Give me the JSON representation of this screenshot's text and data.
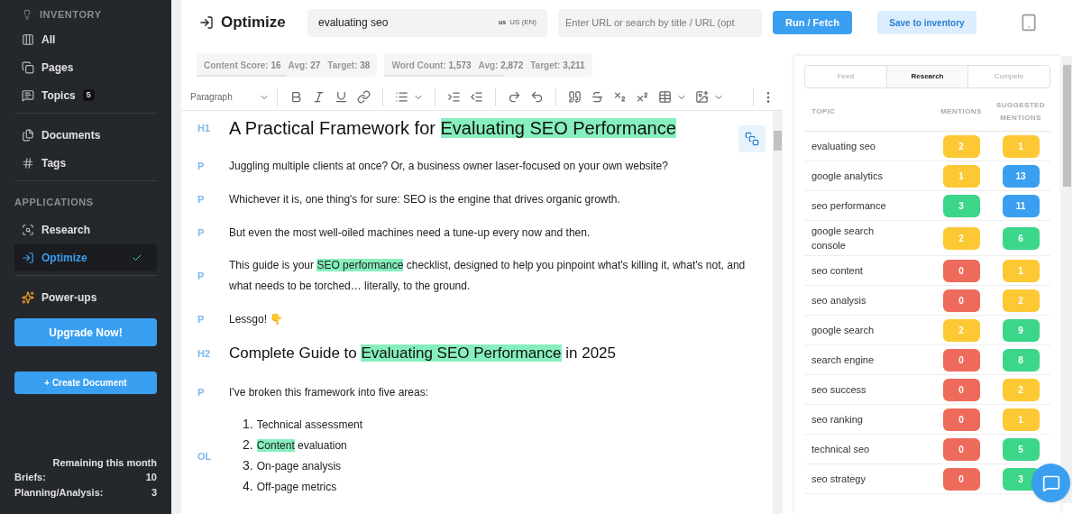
{
  "sidebar": {
    "sections": [
      {
        "heading": "INVENTORY",
        "items": [
          {
            "label": "All",
            "selected": false
          },
          {
            "label": "Pages",
            "selected": false
          },
          {
            "label": "Topics",
            "badge": "5",
            "selected": false
          }
        ]
      },
      {
        "items": [
          {
            "label": "Documents",
            "selected": false
          },
          {
            "label": "Tags",
            "selected": false
          }
        ]
      },
      {
        "heading": "APPLICATIONS",
        "items": [
          {
            "label": "Research",
            "selected": false
          },
          {
            "label": "Optimize",
            "selected": true
          }
        ]
      },
      {
        "items": [
          {
            "label": "Power-ups",
            "selected": false
          }
        ]
      }
    ],
    "upgrade_button": "Upgrade Now!",
    "create_button": "+ Create Document",
    "quota": {
      "title": "Remaining this month",
      "rows": [
        {
          "label": "Briefs:",
          "value": "10"
        },
        {
          "label": "Planning/Analysis:",
          "value": "3"
        }
      ]
    }
  },
  "topbar": {
    "title": "Optimize",
    "keyword": {
      "value": "evaluating seo",
      "flag": "us",
      "locale": "US (EN)"
    },
    "url_field": {
      "placeholder": "Enter URL or search by title / URL (opt"
    },
    "run_button": "Run / Fetch",
    "save_button": "Save to inventory"
  },
  "metrics": [
    {
      "parts": [
        {
          "label": "Content Score:",
          "value": "16"
        },
        {
          "label": "Avg:",
          "value": "27"
        },
        {
          "label": "Target:",
          "value": "38"
        }
      ],
      "level": 0.5
    },
    {
      "parts": [
        {
          "label": "Word Count:",
          "value": "1,573"
        },
        {
          "label": "Avg:",
          "value": "2,872"
        },
        {
          "label": "Target:",
          "value": "3,211"
        }
      ],
      "level": 0.57
    }
  ],
  "toolbar": {
    "block_type": "Paragraph"
  },
  "document": [
    {
      "tag": "H1",
      "kind": "h1",
      "segments": [
        {
          "text": "A Practical Framework for ",
          "highlighted": false
        },
        {
          "text": "Evaluating SEO Performance",
          "highlighted": true
        }
      ]
    },
    {
      "tag": "P",
      "kind": "p",
      "segments": [
        {
          "text": "Juggling multiple clients at once? Or, a business owner laser-focused on your own website?",
          "highlighted": false
        }
      ]
    },
    {
      "tag": "P",
      "kind": "p",
      "segments": [
        {
          "text": "Whichever it is, one thing's for sure: SEO is the engine that drives organic growth.",
          "highlighted": false
        }
      ]
    },
    {
      "tag": "P",
      "kind": "p",
      "segments": [
        {
          "text": "But even the most well-oiled machines need a tune-up every now and then.",
          "highlighted": false
        }
      ]
    },
    {
      "tag": "P",
      "kind": "p",
      "segments": [
        {
          "text": "This guide is your ",
          "highlighted": false
        },
        {
          "text": "SEO performance",
          "highlighted": true
        },
        {
          "text": " checklist, designed to help you pinpoint what's killing it, what's not, and what needs to be torched… literally, to the ground.",
          "highlighted": false
        }
      ]
    },
    {
      "tag": "P",
      "kind": "p",
      "segments": [
        {
          "text": "Lessgo! 👇",
          "highlighted": false
        }
      ]
    },
    {
      "tag": "H2",
      "kind": "h2",
      "segments": [
        {
          "text": "Complete Guide to ",
          "highlighted": false
        },
        {
          "text": "Evaluating SEO Performance",
          "highlighted": true
        },
        {
          "text": " in 2025",
          "highlighted": false
        }
      ]
    },
    {
      "tag": "P",
      "kind": "p",
      "segments": [
        {
          "text": "I've broken this framework into five areas:",
          "highlighted": false
        }
      ]
    },
    {
      "tag": "OL",
      "kind": "ol",
      "items": [
        {
          "number": "1.",
          "segments": [
            {
              "text": "Technical assessment",
              "highlighted": false
            }
          ]
        },
        {
          "number": "2.",
          "segments": [
            {
              "text": "Content",
              "highlighted": true
            },
            {
              "text": " evaluation",
              "highlighted": false
            }
          ]
        },
        {
          "number": "3.",
          "segments": [
            {
              "text": "On-page analysis",
              "highlighted": false
            }
          ]
        },
        {
          "number": "4.",
          "segments": [
            {
              "text": "Off-page metrics",
              "highlighted": false
            }
          ]
        }
      ]
    }
  ],
  "panel": {
    "tabs": [
      {
        "label": "Feed",
        "selected": false
      },
      {
        "label": "Research",
        "selected": true
      },
      {
        "label": "Compete",
        "selected": false
      }
    ],
    "columns": [
      "TOPIC",
      "MENTIONS",
      "SUGGESTED MENTIONS"
    ],
    "rows": [
      {
        "topic": "evaluating seo",
        "mentions": {
          "value": "2",
          "color": "#fcc934"
        },
        "suggested": {
          "value": "1",
          "color": "#fcc934"
        }
      },
      {
        "topic": "google analytics",
        "mentions": {
          "value": "1",
          "color": "#fcc934"
        },
        "suggested": {
          "value": "13",
          "color": "#3a9ff0"
        }
      },
      {
        "topic": "seo performance",
        "mentions": {
          "value": "3",
          "color": "#3bd68a"
        },
        "suggested": {
          "value": "11",
          "color": "#3a9ff0"
        }
      },
      {
        "topic": "google search console",
        "mentions": {
          "value": "2",
          "color": "#fcc934"
        },
        "suggested": {
          "value": "6",
          "color": "#3bd68a"
        }
      },
      {
        "topic": "seo content",
        "mentions": {
          "value": "0",
          "color": "#ee6b5c"
        },
        "suggested": {
          "value": "1",
          "color": "#fcc934"
        }
      },
      {
        "topic": "seo analysis",
        "mentions": {
          "value": "0",
          "color": "#ee6b5c"
        },
        "suggested": {
          "value": "2",
          "color": "#fcc934"
        }
      },
      {
        "topic": "google search",
        "mentions": {
          "value": "2",
          "color": "#fcc934"
        },
        "suggested": {
          "value": "9",
          "color": "#3bd68a"
        }
      },
      {
        "topic": "search engine",
        "mentions": {
          "value": "0",
          "color": "#ee6b5c"
        },
        "suggested": {
          "value": "8",
          "color": "#3bd68a"
        }
      },
      {
        "topic": "seo success",
        "mentions": {
          "value": "0",
          "color": "#ee6b5c"
        },
        "suggested": {
          "value": "2",
          "color": "#fcc934"
        }
      },
      {
        "topic": "seo ranking",
        "mentions": {
          "value": "0",
          "color": "#ee6b5c"
        },
        "suggested": {
          "value": "1",
          "color": "#fcc934"
        }
      },
      {
        "topic": "technical seo",
        "mentions": {
          "value": "0",
          "color": "#ee6b5c"
        },
        "suggested": {
          "value": "5",
          "color": "#3bd68a"
        }
      },
      {
        "topic": "seo strategy",
        "mentions": {
          "value": "0",
          "color": "#ee6b5c"
        },
        "suggested": {
          "value": "3",
          "color": "#3bd68a"
        }
      }
    ]
  }
}
